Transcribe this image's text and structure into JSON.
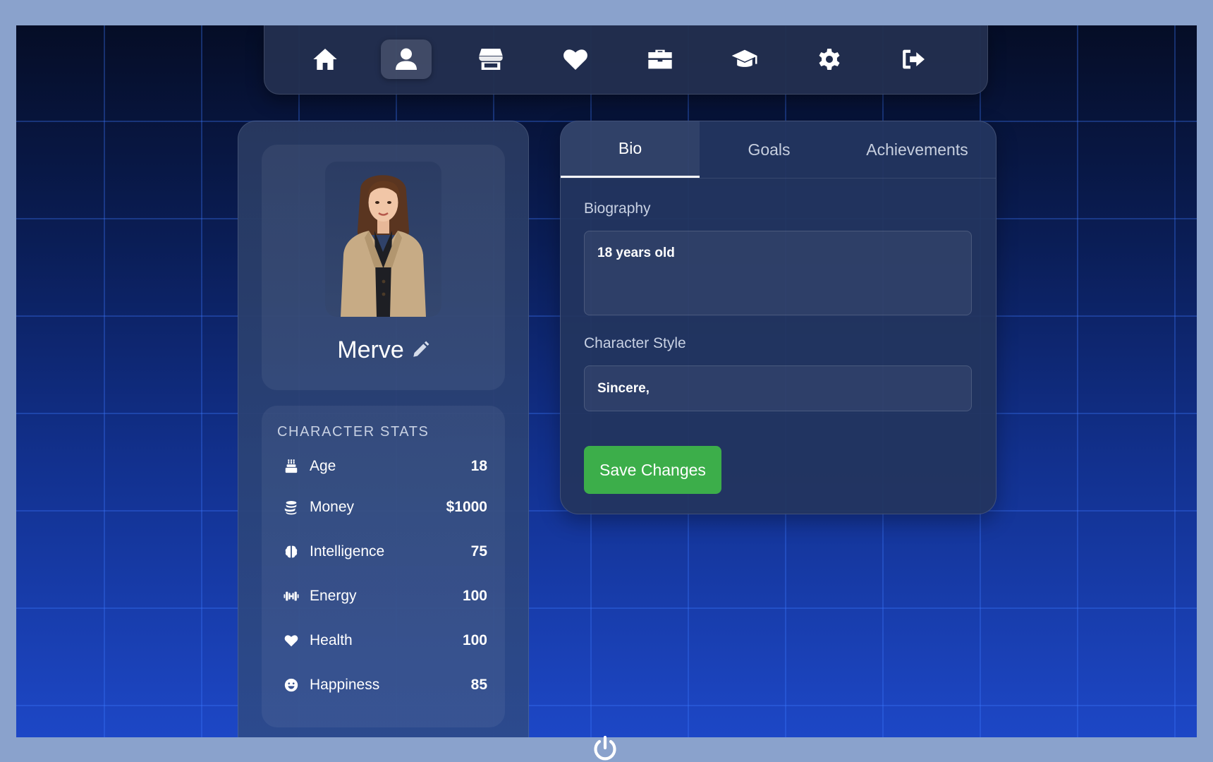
{
  "nav": {
    "items": [
      {
        "id": "home",
        "icon": "home-icon",
        "active": false
      },
      {
        "id": "profile",
        "icon": "user-icon",
        "active": true
      },
      {
        "id": "shop",
        "icon": "store-icon",
        "active": false
      },
      {
        "id": "relationships",
        "icon": "heart-icon",
        "active": false
      },
      {
        "id": "jobs",
        "icon": "briefcase-icon",
        "active": false
      },
      {
        "id": "education",
        "icon": "graduation-cap-icon",
        "active": false
      },
      {
        "id": "settings",
        "icon": "gear-icon",
        "active": false
      },
      {
        "id": "logout",
        "icon": "sign-out-icon",
        "active": false
      }
    ]
  },
  "profile": {
    "name": "Merve",
    "avatar_icon": "character-portrait"
  },
  "stats": {
    "title": "CHARACTER STATS",
    "items": [
      {
        "icon": "birthday-cake-icon",
        "label": "Age",
        "value": "18"
      },
      {
        "icon": "coins-icon",
        "label": "Money",
        "value": "$1000"
      },
      {
        "icon": "brain-icon",
        "label": "Intelligence",
        "value": "75"
      },
      {
        "icon": "dumbbell-icon",
        "label": "Energy",
        "value": "100"
      },
      {
        "icon": "heart-icon",
        "label": "Health",
        "value": "100"
      },
      {
        "icon": "smile-icon",
        "label": "Happiness",
        "value": "85"
      }
    ]
  },
  "tabs": {
    "items": [
      {
        "label": "Bio",
        "active": true
      },
      {
        "label": "Goals",
        "active": false
      },
      {
        "label": "Achievements",
        "active": false
      }
    ]
  },
  "bio": {
    "biography_label": "Biography",
    "biography_value": "18 years old",
    "style_label": "Character Style",
    "style_value": "Sincere,",
    "save_label": "Save Changes"
  },
  "colors": {
    "save_button": "#3cae4a",
    "page_frame": "#8aa2cc",
    "panel": "#23355f"
  },
  "footer": {
    "icon": "power-icon"
  }
}
